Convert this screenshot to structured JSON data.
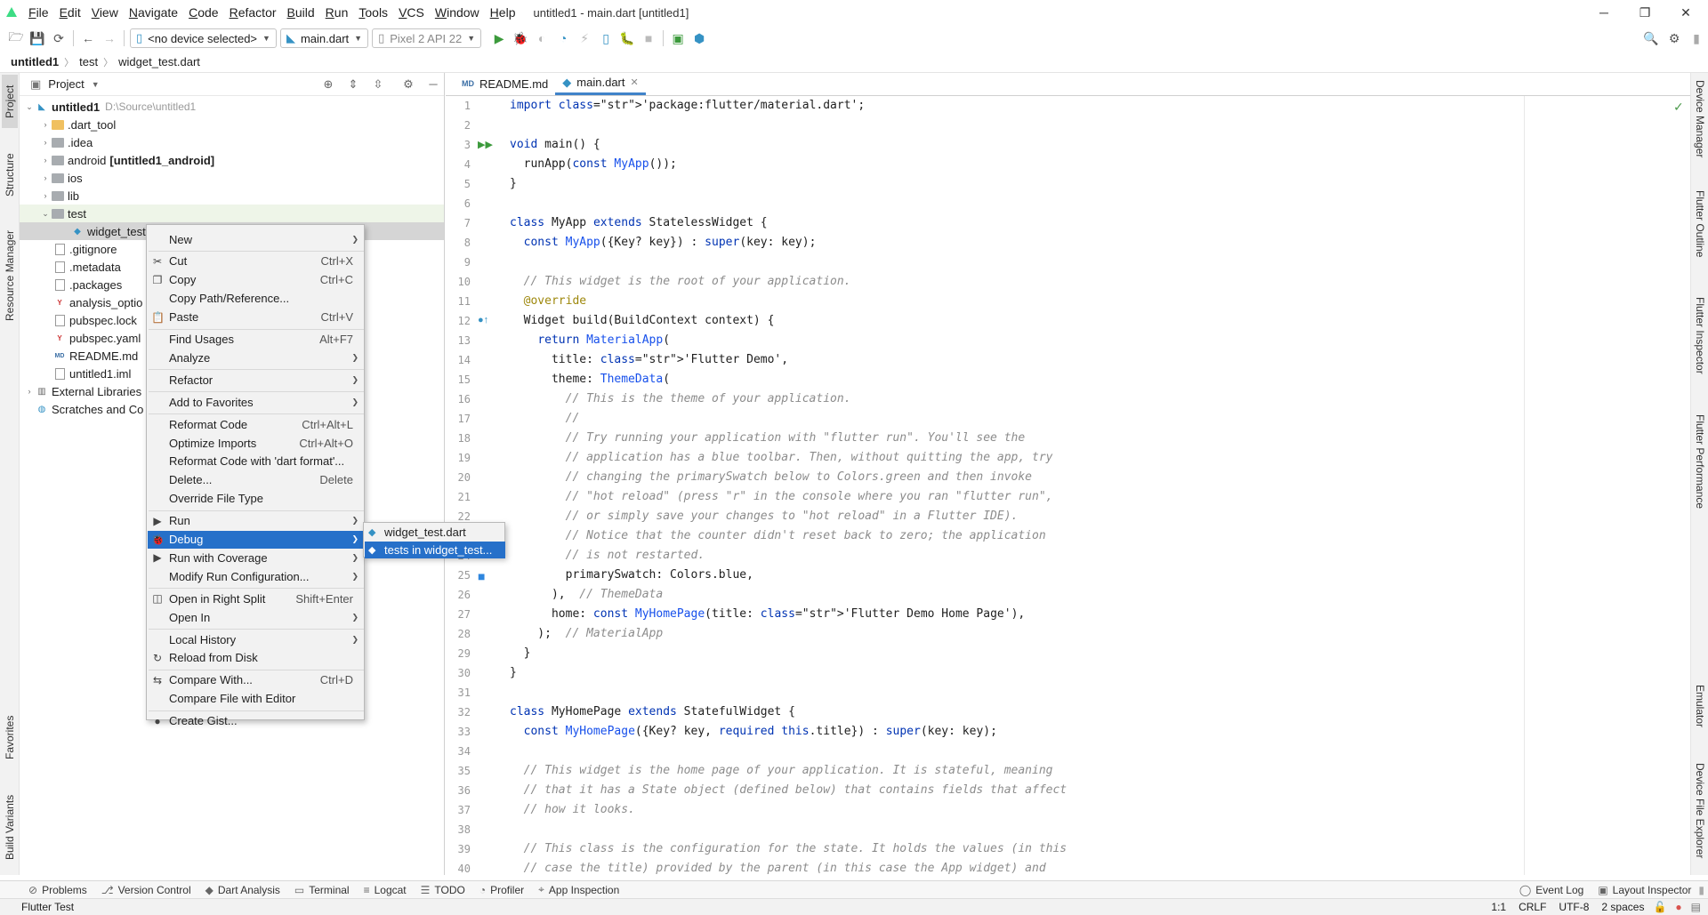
{
  "menu": [
    "File",
    "Edit",
    "View",
    "Navigate",
    "Code",
    "Refactor",
    "Build",
    "Run",
    "Tools",
    "VCS",
    "Window",
    "Help"
  ],
  "window_title": "untitled1 - main.dart [untitled1]",
  "toolbar": {
    "device": "<no device selected>",
    "run_config": "main.dart",
    "emulator": "Pixel 2 API 22"
  },
  "breadcrumb": [
    "untitled1",
    "test",
    "widget_test.dart"
  ],
  "left_tabs": [
    "Project",
    "Structure",
    "Resource Manager",
    "Favorites",
    "Build Variants"
  ],
  "right_tabs": [
    "Device Manager",
    "Flutter Outline",
    "Flutter Inspector",
    "Flutter Performance",
    "Emulator",
    "Device File Explorer"
  ],
  "project_panel": {
    "title": "Project",
    "root": {
      "name": "untitled1",
      "path": "D:\\Source\\untitled1"
    },
    "items": [
      {
        "name": ".dart_tool",
        "type": "folder"
      },
      {
        "name": ".idea",
        "type": "folder-grey"
      },
      {
        "name": "android",
        "suffix": "[untitled1_android]",
        "type": "folder-grey"
      },
      {
        "name": "ios",
        "type": "folder-grey"
      },
      {
        "name": "lib",
        "type": "folder-grey"
      },
      {
        "name": "test",
        "type": "folder-grey"
      },
      {
        "name": "widget_test",
        "type": "dart"
      },
      {
        "name": ".gitignore",
        "type": "file"
      },
      {
        "name": ".metadata",
        "type": "file"
      },
      {
        "name": ".packages",
        "type": "file"
      },
      {
        "name": "analysis_optio",
        "type": "yml"
      },
      {
        "name": "pubspec.lock",
        "type": "file"
      },
      {
        "name": "pubspec.yaml",
        "type": "yml"
      },
      {
        "name": "README.md",
        "type": "md"
      },
      {
        "name": "untitled1.iml",
        "type": "file"
      },
      {
        "name": "External Libraries",
        "type": "lib"
      },
      {
        "name": "Scratches and Co",
        "type": "scratch"
      }
    ]
  },
  "editor_tabs": [
    {
      "label": "README.md"
    },
    {
      "label": "main.dart"
    }
  ],
  "code_lines": [
    "import 'package:flutter/material.dart';",
    "",
    "void main() {",
    "  runApp(const MyApp());",
    "}",
    "",
    "class MyApp extends StatelessWidget {",
    "  const MyApp({Key? key}) : super(key: key);",
    "",
    "  // This widget is the root of your application.",
    "  @override",
    "  Widget build(BuildContext context) {",
    "    return MaterialApp(",
    "      title: 'Flutter Demo',",
    "      theme: ThemeData(",
    "        // This is the theme of your application.",
    "        //",
    "        // Try running your application with \"flutter run\". You'll see the",
    "        // application has a blue toolbar. Then, without quitting the app, try",
    "        // changing the primarySwatch below to Colors.green and then invoke",
    "        // \"hot reload\" (press \"r\" in the console where you ran \"flutter run\",",
    "        // or simply save your changes to \"hot reload\" in a Flutter IDE).",
    "        // Notice that the counter didn't reset back to zero; the application",
    "        // is not restarted.",
    "        primarySwatch: Colors.blue,",
    "      ),  // ThemeData",
    "      home: const MyHomePage(title: 'Flutter Demo Home Page'),",
    "    );  // MaterialApp",
    "  }",
    "}",
    "",
    "class MyHomePage extends StatefulWidget {",
    "  const MyHomePage({Key? key, required this.title}) : super(key: key);",
    "",
    "  // This widget is the home page of your application. It is stateful, meaning",
    "  // that it has a State object (defined below) that contains fields that affect",
    "  // how it looks.",
    "",
    "  // This class is the configuration for the state. It holds the values (in this",
    "  // case the title) provided by the parent (in this case the App widget) and"
  ],
  "context_menu": [
    {
      "label": "New",
      "sub": true
    },
    {
      "sep": true
    },
    {
      "label": "Cut",
      "shortcut": "Ctrl+X",
      "icon": "✂"
    },
    {
      "label": "Copy",
      "shortcut": "Ctrl+C",
      "icon": "❐"
    },
    {
      "label": "Copy Path/Reference..."
    },
    {
      "label": "Paste",
      "shortcut": "Ctrl+V",
      "icon": "📋"
    },
    {
      "sep": true
    },
    {
      "label": "Find Usages",
      "shortcut": "Alt+F7"
    },
    {
      "label": "Analyze",
      "sub": true
    },
    {
      "sep": true
    },
    {
      "label": "Refactor",
      "sub": true
    },
    {
      "sep": true
    },
    {
      "label": "Add to Favorites",
      "sub": true
    },
    {
      "sep": true
    },
    {
      "label": "Reformat Code",
      "shortcut": "Ctrl+Alt+L"
    },
    {
      "label": "Optimize Imports",
      "shortcut": "Ctrl+Alt+O"
    },
    {
      "label": "Reformat Code with 'dart format'..."
    },
    {
      "label": "Delete...",
      "shortcut": "Delete"
    },
    {
      "label": "Override File Type"
    },
    {
      "sep": true
    },
    {
      "label": "Run",
      "sub": true,
      "icon": "▶"
    },
    {
      "label": "Debug",
      "sub": true,
      "icon": "🐞",
      "selected": true
    },
    {
      "label": "Run with Coverage",
      "sub": true,
      "icon": "▶"
    },
    {
      "label": "Modify Run Configuration...",
      "sub": true
    },
    {
      "sep": true
    },
    {
      "label": "Open in Right Split",
      "shortcut": "Shift+Enter",
      "icon": "◫"
    },
    {
      "label": "Open In",
      "sub": true
    },
    {
      "sep": true
    },
    {
      "label": "Local History",
      "sub": true
    },
    {
      "label": "Reload from Disk",
      "icon": "↻"
    },
    {
      "sep": true
    },
    {
      "label": "Compare With...",
      "shortcut": "Ctrl+D",
      "icon": "⇆"
    },
    {
      "label": "Compare File with Editor"
    },
    {
      "sep": true
    },
    {
      "label": "Create Gist...",
      "icon": "●"
    }
  ],
  "submenu": [
    {
      "label": "widget_test.dart"
    },
    {
      "label": "tests in widget_test...",
      "selected": true
    }
  ],
  "bottom_tabs": [
    "Problems",
    "Version Control",
    "Dart Analysis",
    "Terminal",
    "Logcat",
    "TODO",
    "Profiler",
    "App Inspection"
  ],
  "bottom_right_tabs": [
    "Event Log",
    "Layout Inspector"
  ],
  "status": {
    "left": "Flutter Test",
    "pos": "1:1",
    "eol": "CRLF",
    "enc": "UTF-8",
    "indent": "2 spaces"
  }
}
